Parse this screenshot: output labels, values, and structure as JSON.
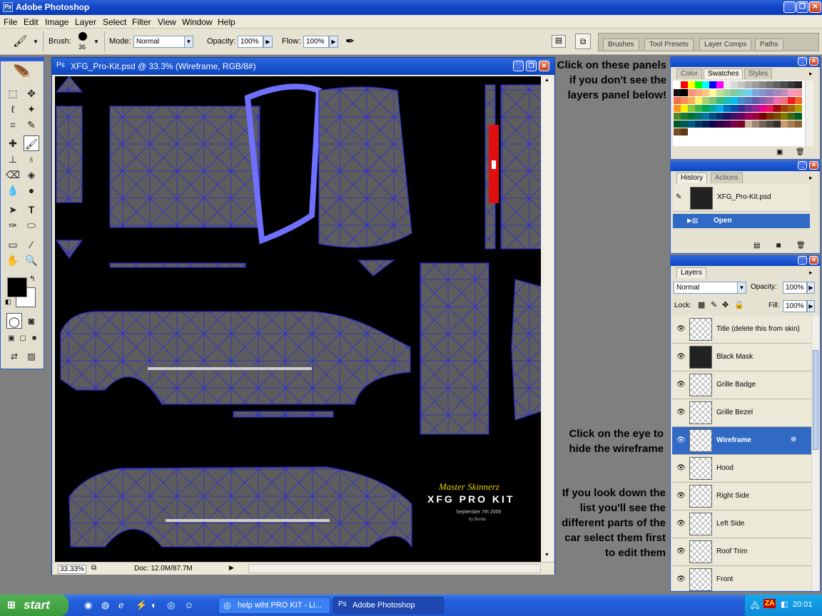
{
  "window": {
    "title": "Adobe Photoshop"
  },
  "menu": [
    "File",
    "Edit",
    "Image",
    "Layer",
    "Select",
    "Filter",
    "View",
    "Window",
    "Help"
  ],
  "options": {
    "brush_label": "Brush:",
    "brush_size": "36",
    "mode_label": "Mode:",
    "mode_value": "Normal",
    "opacity_label": "Opacity:",
    "opacity_value": "100%",
    "flow_label": "Flow:",
    "flow_value": "100%"
  },
  "palette_well_tabs": [
    "Brushes",
    "Tool Presets",
    "Layer Comps",
    "Paths"
  ],
  "document": {
    "title": "XFG_Pro-Kit.psd @ 33.3% (Wireframe, RGB/8#)",
    "zoom": "33.33%",
    "doc_size": "Doc: 12.0M/87.7M",
    "watermark": {
      "line1": "Master Skinnerz",
      "line2": "XFG PRO KIT",
      "line3": "September 7th   2006",
      "line4": "by Bunta"
    }
  },
  "notes": {
    "panels_hint": [
      "Click on these panels",
      "if you don't see the",
      "layers panel  below!"
    ],
    "eye_hint": [
      "Click on the eye to",
      "hide the wireframe"
    ],
    "list_hint": [
      "If you look down the",
      "list you'll see the",
      "different parts of the",
      "car select them first",
      "to edit them"
    ]
  },
  "swatches_panel": {
    "tabs": [
      "Color",
      "Swatches",
      "Styles"
    ],
    "active_tab": "Swatches",
    "colors": [
      "#ffffff",
      "#ff0000",
      "#ffff00",
      "#00ff00",
      "#00ffff",
      "#0000ff",
      "#ff00ff",
      "#ececec",
      "#d8d8d8",
      "#c4c4c4",
      "#b0b0b0",
      "#9c9c9c",
      "#888888",
      "#747474",
      "#606060",
      "#4c4c4c",
      "#383838",
      "#242424",
      "#101010",
      "#000000",
      "#f7977a",
      "#f9ad81",
      "#fdc68a",
      "#fff79a",
      "#c4df9b",
      "#a2d39c",
      "#82ca9d",
      "#7bcdc8",
      "#6ecff6",
      "#7ea7d8",
      "#8493ca",
      "#8882be",
      "#a187be",
      "#bc8dbf",
      "#f49ac2",
      "#f6989d",
      "#f26c4f",
      "#f68e55",
      "#fbaf5c",
      "#fff467",
      "#acd372",
      "#7cc576",
      "#3bb878",
      "#1abbb4",
      "#00bff3",
      "#438ccb",
      "#5574b9",
      "#605ca8",
      "#855fa8",
      "#a763a8",
      "#f06ea9",
      "#f26d7d",
      "#ed1c24",
      "#f26522",
      "#f7941d",
      "#fff200",
      "#8dc73f",
      "#39b54a",
      "#00a651",
      "#00a99d",
      "#00aeef",
      "#0072bc",
      "#0054a6",
      "#2e3192",
      "#662d91",
      "#92278f",
      "#ec008c",
      "#ed145b",
      "#9e0b0f",
      "#a0410d",
      "#a36209",
      "#aba000",
      "#598527",
      "#1a7b30",
      "#007236",
      "#00746b",
      "#0076a3",
      "#004b80",
      "#003471",
      "#1b1464",
      "#440e62",
      "#630460",
      "#9e005d",
      "#9e0039",
      "#790000",
      "#7b2e00",
      "#7d4900",
      "#827b00",
      "#406618",
      "#005e20",
      "#005826",
      "#005952",
      "#005b7f",
      "#003663",
      "#002157",
      "#0d004c",
      "#32004b",
      "#4b0049",
      "#7b0046",
      "#7a0026",
      "#c7b299",
      "#998675",
      "#736357",
      "#534741",
      "#362f2d",
      "#c69c6d",
      "#a67c52",
      "#8c6239",
      "#754c24",
      "#603913"
    ]
  },
  "history_panel": {
    "tabs": [
      "History",
      "Actions"
    ],
    "active_tab": "History",
    "snapshot": "XFG_Pro-Kit.psd",
    "state": "Open"
  },
  "layers_panel": {
    "tab": "Layers",
    "blend_mode": "Normal",
    "opacity_label": "Opacity:",
    "opacity_value": "100%",
    "lock_label": "Lock:",
    "fill_label": "Fill:",
    "fill_value": "100%",
    "layers": [
      {
        "name": "Title (delete this from skin)",
        "selected": false
      },
      {
        "name": "Black Mask",
        "selected": false
      },
      {
        "name": "Grille Badge",
        "selected": false
      },
      {
        "name": "Grille Bezel",
        "selected": false
      },
      {
        "name": "Wireframe",
        "selected": true
      },
      {
        "name": "Hood",
        "selected": false
      },
      {
        "name": "Right Side",
        "selected": false
      },
      {
        "name": "Left Side",
        "selected": false
      },
      {
        "name": "Roof Trim",
        "selected": false
      },
      {
        "name": "Front",
        "selected": false
      }
    ]
  },
  "taskbar": {
    "start": "start",
    "items": [
      "help wiht PRO KIT - Li...",
      "Adobe Photoshop"
    ],
    "clock": "20:01",
    "tray_badge": "ZA"
  }
}
